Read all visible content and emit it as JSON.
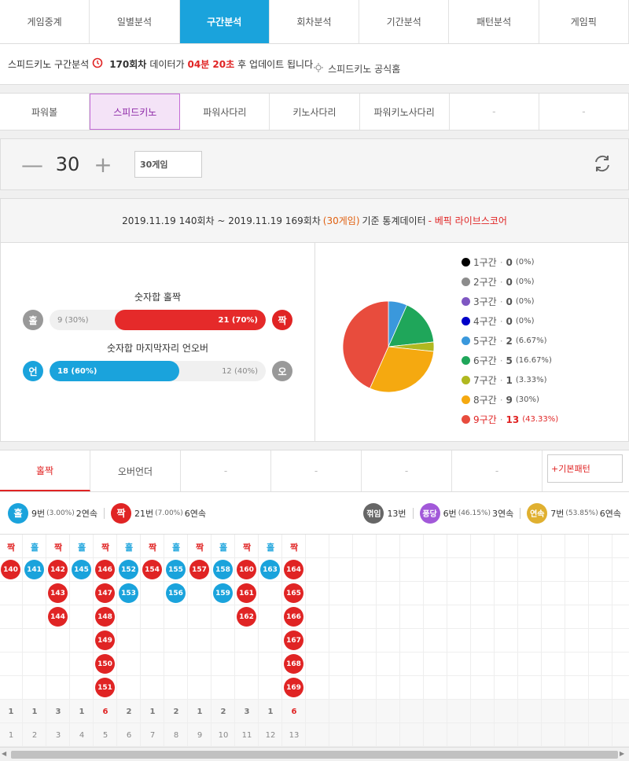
{
  "tabs": [
    "게임중계",
    "일별분석",
    "구간분석",
    "회차분석",
    "기간분석",
    "패턴분석",
    "게임픽"
  ],
  "active_tab": 2,
  "info": {
    "prefix": "스피드키노 구간분석",
    "round": "170회차",
    "mid": "데이터가",
    "time": "04분 20초",
    "suffix": "후 업데이트 됩니다",
    "official": "스피드키노 공식홈"
  },
  "game_tabs": [
    "파워볼",
    "스피드키노",
    "파워사다리",
    "키노사다리",
    "파워키노사다리",
    "-",
    "-"
  ],
  "active_game": 1,
  "control": {
    "minus": "—",
    "value": "30",
    "plus": "+",
    "select": "30게임"
  },
  "stats": {
    "head_a": "2019.11.19 140회차 ~ 2019.11.19 169회차",
    "head_games": "(30게임)",
    "head_b": "기준 통계데이터",
    "head_c": "- 베픽 라이브스코어",
    "oddeven_title": "숫자합 홀짝",
    "odd_label": "홀",
    "even_label": "짝",
    "odd_text": "9 (30%)",
    "even_text": "21 (70%)",
    "even_pct": 70,
    "ou_title": "숫자합 마지막자리 언오버",
    "under_label": "언",
    "over_label": "오",
    "under_text": "18 (60%)",
    "over_text": "12 (40%)",
    "under_pct": 60
  },
  "colors": {
    "odd": "#1aa3dc",
    "even": "#e02424",
    "gray": "#999"
  },
  "sections": [
    {
      "label": "1구간",
      "count": "0",
      "pct": "(0%)",
      "color": "#000000",
      "value": 0
    },
    {
      "label": "2구간",
      "count": "0",
      "pct": "(0%)",
      "color": "#8c8c8c",
      "value": 0
    },
    {
      "label": "3구간",
      "count": "0",
      "pct": "(0%)",
      "color": "#7e57c2",
      "value": 0
    },
    {
      "label": "4구간",
      "count": "0",
      "pct": "(0%)",
      "color": "#0000c8",
      "value": 0
    },
    {
      "label": "5구간",
      "count": "2",
      "pct": "(6.67%)",
      "color": "#3a98dc",
      "value": 2
    },
    {
      "label": "6구간",
      "count": "5",
      "pct": "(16.67%)",
      "color": "#1fa65a",
      "value": 5
    },
    {
      "label": "7구간",
      "count": "1",
      "pct": "(3.33%)",
      "color": "#b0b820",
      "value": 1
    },
    {
      "label": "8구간",
      "count": "9",
      "pct": "(30%)",
      "color": "#f5a910",
      "value": 9
    },
    {
      "label": "9구간",
      "count": "13",
      "pct": "(43.33%)",
      "color": "#e84c3d",
      "value": 13
    }
  ],
  "pattern_tabs": [
    "홀짝",
    "오버언더",
    "-",
    "-",
    "-",
    "-"
  ],
  "pattern_button": "+기본패턴",
  "summary": {
    "odd": "홀",
    "odd_count": "9번",
    "odd_pct": "(3.00%)",
    "odd_streak": "2연속",
    "even": "짝",
    "even_count": "21번",
    "even_pct": "(7.00%)",
    "even_streak": "6연속",
    "break": "꺾임",
    "break_count": "13번",
    "pong": "퐁당",
    "pong_count": "6번",
    "pong_pct": "(46.15%)",
    "pong_streak": "3연속",
    "cont": "연속",
    "cont_count": "7번",
    "cont_pct": "(53.85%)",
    "cont_streak": "6연속"
  },
  "columns": [
    {
      "type": "짝",
      "balls": [
        "140"
      ]
    },
    {
      "type": "홀",
      "balls": [
        "141"
      ]
    },
    {
      "type": "짝",
      "balls": [
        "142",
        "143",
        "144"
      ]
    },
    {
      "type": "홀",
      "balls": [
        "145"
      ]
    },
    {
      "type": "짝",
      "balls": [
        "146",
        "147",
        "148",
        "149",
        "150",
        "151"
      ]
    },
    {
      "type": "홀",
      "balls": [
        "152",
        "153"
      ]
    },
    {
      "type": "짝",
      "balls": [
        "154"
      ]
    },
    {
      "type": "홀",
      "balls": [
        "155",
        "156"
      ]
    },
    {
      "type": "짝",
      "balls": [
        "157"
      ]
    },
    {
      "type": "홀",
      "balls": [
        "158",
        "159"
      ]
    },
    {
      "type": "짝",
      "balls": [
        "160",
        "161",
        "162"
      ]
    },
    {
      "type": "홀",
      "balls": [
        "163"
      ]
    },
    {
      "type": "짝",
      "balls": [
        "164",
        "165",
        "166",
        "167",
        "168",
        "169"
      ]
    }
  ],
  "column_counts": [
    "1",
    "1",
    "3",
    "1",
    "6",
    "2",
    "1",
    "2",
    "1",
    "2",
    "3",
    "1",
    "6"
  ],
  "column_index": [
    "1",
    "2",
    "3",
    "4",
    "5",
    "6",
    "7",
    "8",
    "9",
    "10",
    "11",
    "12",
    "13"
  ]
}
